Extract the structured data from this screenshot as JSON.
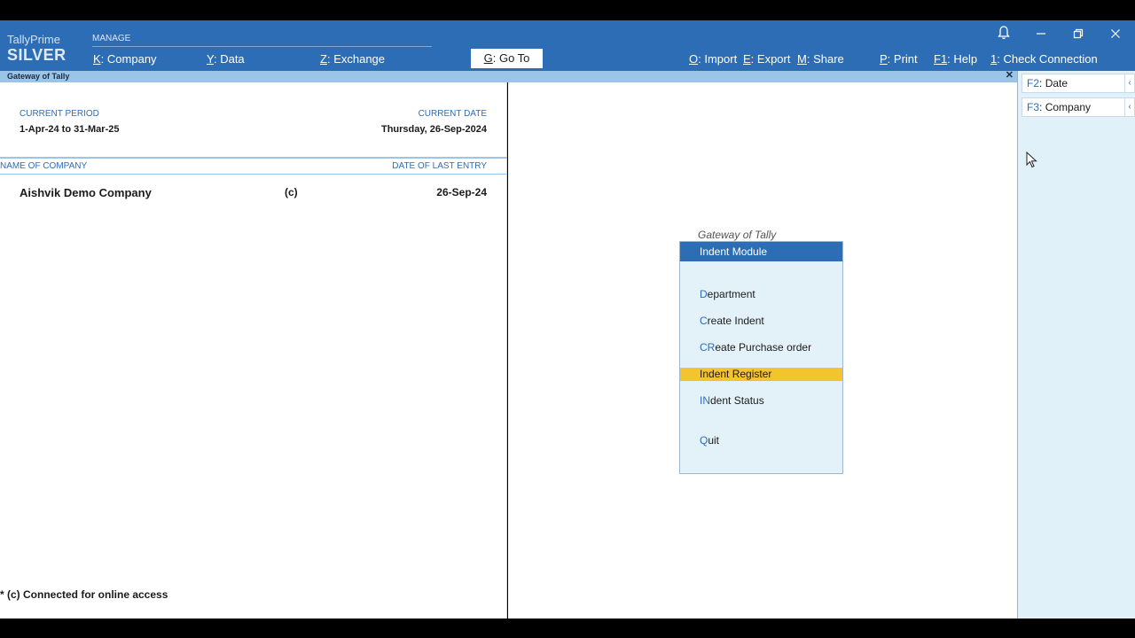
{
  "header": {
    "brand": "TallyPrime",
    "edition": "SILVER",
    "manage_label": "MANAGE",
    "menu": [
      {
        "key": "K",
        "label": "Company"
      },
      {
        "key": "Y",
        "label": "Data"
      },
      {
        "key": "Z",
        "label": "Exchange"
      }
    ],
    "goto": {
      "key": "G",
      "label": "Go To"
    },
    "actions": [
      {
        "key": "O",
        "label": "Import"
      },
      {
        "key": "E",
        "label": "Export"
      },
      {
        "key": "M",
        "label": "Share"
      },
      {
        "key": "P",
        "label": "Print"
      },
      {
        "key": "F1",
        "label": "Help"
      },
      {
        "key": "1",
        "label": "Check Connection"
      }
    ],
    "window_icons": [
      "bell-icon",
      "minimize-icon",
      "restore-icon",
      "close-icon"
    ]
  },
  "subbar": {
    "title": "Gateway of Tally",
    "close_glyph": "✕"
  },
  "left": {
    "current_period_label": "CURRENT PERIOD",
    "current_period_value": "1-Apr-24 to 31-Mar-25",
    "current_date_label": "CURRENT DATE",
    "current_date_value": "Thursday, 26-Sep-2024",
    "name_of_company_label": "NAME OF COMPANY",
    "date_of_last_entry_label": "DATE OF LAST ENTRY",
    "company": {
      "name": "Aishvik Demo Company",
      "flag": "(c)",
      "last_entry": "26-Sep-24"
    },
    "footnote": "* (c) Connected for online access"
  },
  "gateway": {
    "caption": "Gateway of Tally",
    "header": "Indent Module",
    "items": [
      {
        "key": "D",
        "rest": "epartment",
        "selected": false
      },
      {
        "key": "C",
        "rest": "reate Indent",
        "selected": false
      },
      {
        "key": "CR",
        "rest": "eate Purchase order",
        "selected": false
      },
      {
        "key": "I",
        "rest": "ndent Register",
        "selected": true
      },
      {
        "key": "IN",
        "rest": "dent Status",
        "selected": false
      },
      {
        "key": "Q",
        "rest": "uit",
        "selected": false
      }
    ]
  },
  "right": {
    "buttons": [
      {
        "key": "F2",
        "label": "Date"
      },
      {
        "key": "F3",
        "label": "Company"
      }
    ],
    "chevron": "‹"
  }
}
